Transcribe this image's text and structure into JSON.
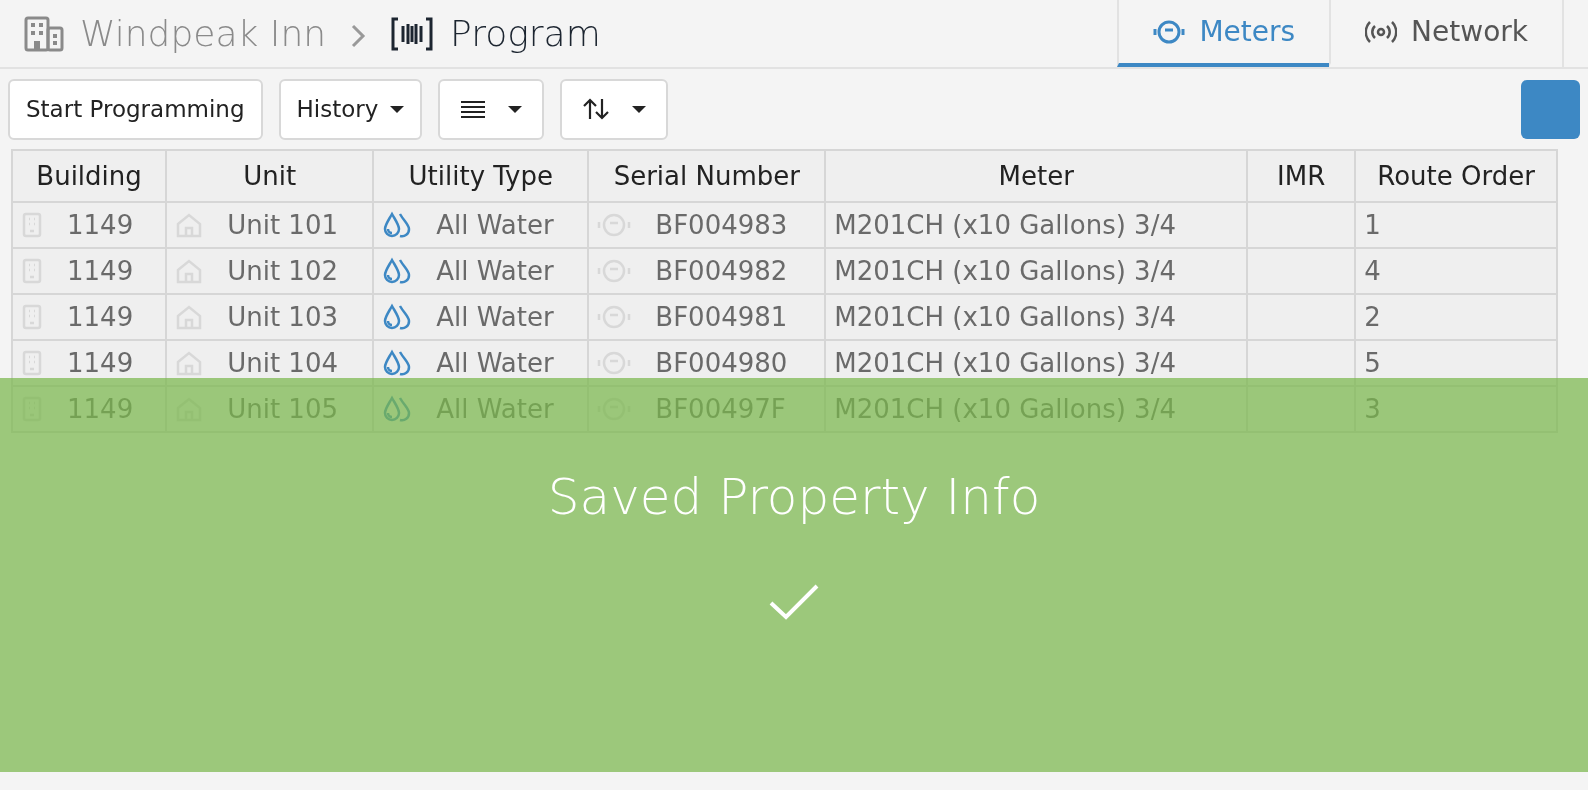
{
  "breadcrumb": [
    {
      "label": "Windpeak Inn",
      "kind": "building",
      "current": false
    },
    {
      "label": "Program",
      "kind": "program",
      "current": true
    }
  ],
  "tabs": [
    {
      "label": "Meters",
      "kind": "meter",
      "selected": true
    },
    {
      "label": "Network",
      "kind": "network",
      "selected": false
    }
  ],
  "toolbar": [
    {
      "label": "Start Programming",
      "kind": "text",
      "dropdown": false
    },
    {
      "label": "History",
      "kind": "text",
      "dropdown": true
    },
    {
      "kind": "list",
      "dropdown": true
    },
    {
      "kind": "sort",
      "dropdown": true
    },
    {
      "kind": "square"
    }
  ],
  "table": {
    "columns": [
      "Building",
      "Unit",
      "Utility Type",
      "Serial Number",
      "Meter",
      "IMR",
      "Route Order"
    ],
    "rows": [
      {
        "building": "1149",
        "unit": "Unit 101",
        "utility": "All Water",
        "serial": "BF004983",
        "meter": "M201CH (x10 Gallons) 3/4",
        "route_order": "1"
      },
      {
        "building": "1149",
        "unit": "Unit 102",
        "utility": "All Water",
        "serial": "BF004982",
        "meter": "M201CH (x10 Gallons) 3/4",
        "route_order": "4"
      },
      {
        "building": "1149",
        "unit": "Unit 103",
        "utility": "All Water",
        "serial": "BF004981",
        "meter": "M201CH (x10 Gallons) 3/4",
        "route_order": "2"
      },
      {
        "building": "1149",
        "unit": "Unit 104",
        "utility": "All Water",
        "serial": "BF004980",
        "meter": "M201CH (x10 Gallons) 3/4",
        "route_order": "5"
      },
      {
        "building": "1149",
        "unit": "Unit 105",
        "utility": "All Water",
        "serial": "BF00497F",
        "meter": "M201CH (x10 Gallons) 3/4",
        "route_order": "3"
      }
    ]
  },
  "notification": {
    "message": "Saved Property Info",
    "kind": "success"
  }
}
